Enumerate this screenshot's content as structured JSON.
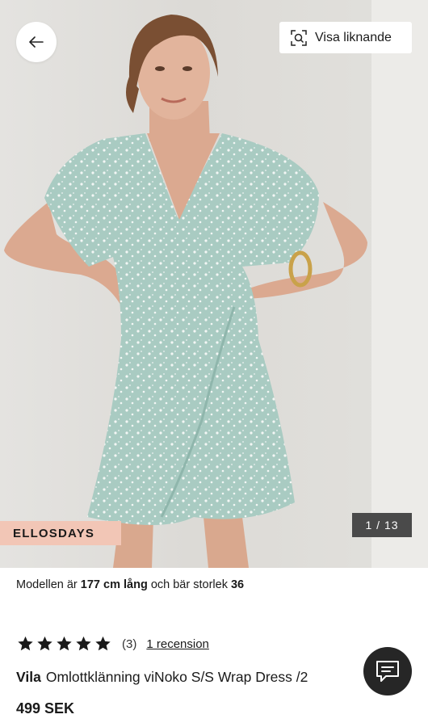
{
  "hero": {
    "similar_button_label": "Visa liknande",
    "promo_tag": "ELLOSDAYS",
    "image_counter": "1 / 13"
  },
  "model_info": {
    "prefix": "Modellen är ",
    "height": "177 cm lång",
    "middle": " och bär storlek ",
    "size": "36"
  },
  "rating": {
    "stars": 5,
    "count": "(3)",
    "review_link": "1 recension"
  },
  "product": {
    "brand": "Vila",
    "name": "Omlottklänning viNoko S/S Wrap Dress /2",
    "price": "499 SEK"
  },
  "icons": {
    "back": "arrow-left-icon",
    "similar": "visual-search-icon",
    "chat": "chat-icon",
    "star": "star-icon"
  },
  "colors": {
    "promo_bg": "#f2c6b6",
    "counter_bg": "#4a4a4a",
    "chat_bg": "#262626",
    "dress": "#a9cbc2"
  }
}
